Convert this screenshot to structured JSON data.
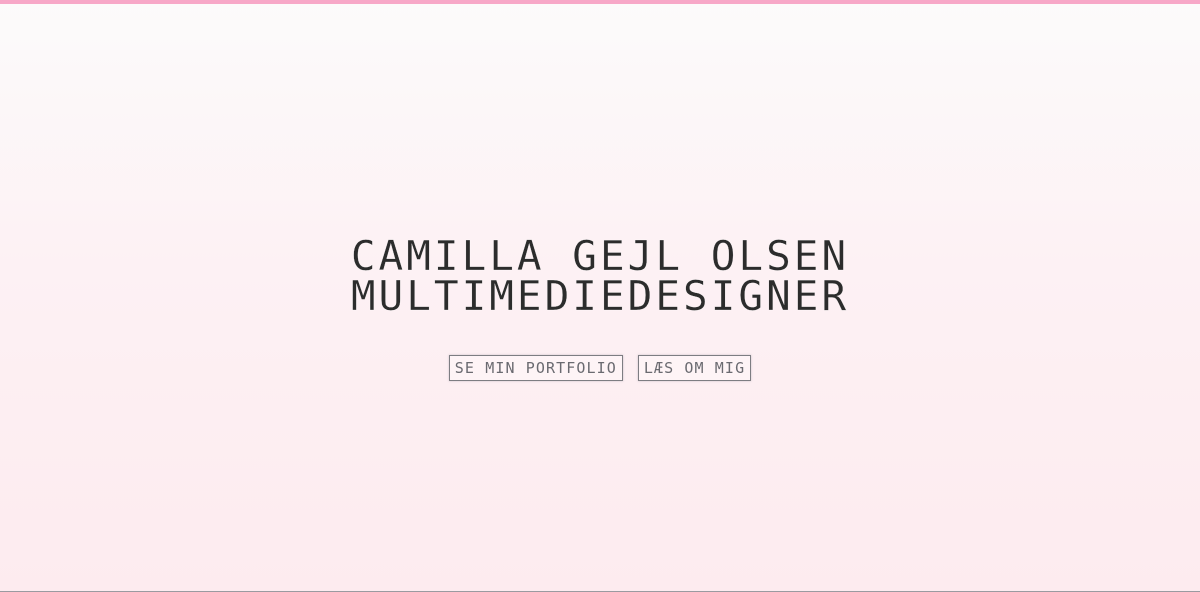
{
  "hero": {
    "name": "CAMILLA GEJL OLSEN",
    "role": "MULTIMEDIEDESIGNER"
  },
  "actions": {
    "portfolio_label": "SE MIN PORTFOLIO",
    "about_label": "LÆS OM MIG"
  },
  "colors": {
    "accent_bar": "#f7a8c8",
    "text": "#2c2c2c",
    "button_text": "#6a6a70"
  }
}
